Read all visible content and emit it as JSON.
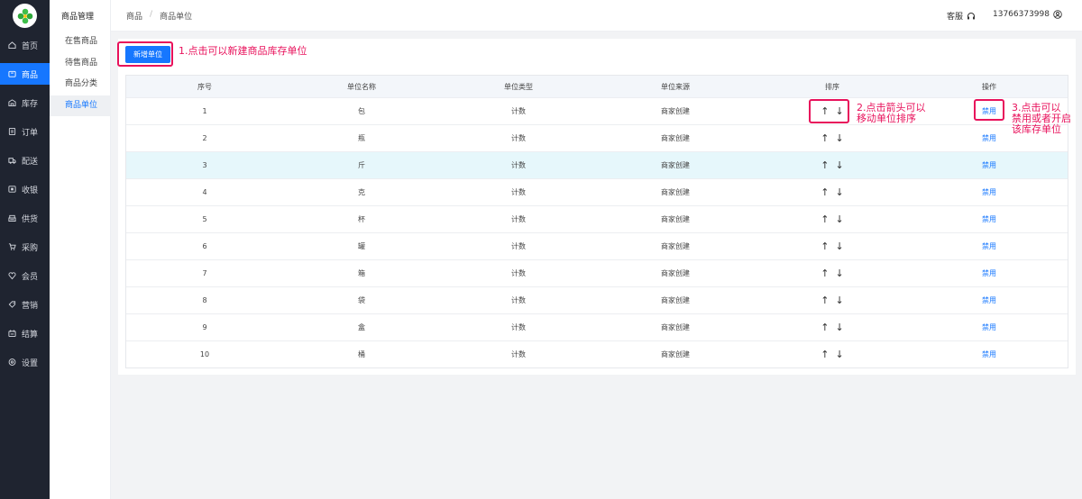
{
  "sidebar": {
    "items": [
      {
        "label": "首页",
        "icon": "home-icon"
      },
      {
        "label": "商品",
        "icon": "product-icon"
      },
      {
        "label": "库存",
        "icon": "inventory-icon"
      },
      {
        "label": "订单",
        "icon": "order-icon"
      },
      {
        "label": "配送",
        "icon": "truck-icon"
      },
      {
        "label": "收银",
        "icon": "cashier-icon"
      },
      {
        "label": "供货",
        "icon": "supply-icon"
      },
      {
        "label": "采购",
        "icon": "cart-icon"
      },
      {
        "label": "会员",
        "icon": "member-icon"
      },
      {
        "label": "营销",
        "icon": "tag-icon"
      },
      {
        "label": "结算",
        "icon": "settle-icon"
      },
      {
        "label": "设置",
        "icon": "settings-icon"
      }
    ],
    "active_index": 1
  },
  "subside": {
    "title": "商品管理",
    "items": [
      "在售商品",
      "待售商品",
      "商品分类",
      "商品单位"
    ],
    "active_index": 3
  },
  "header": {
    "breadcrumb": [
      "商品",
      "商品单位"
    ],
    "service_label": "客服",
    "phone": "13766373998"
  },
  "toolbar": {
    "add_label": "新增单位"
  },
  "annotations": {
    "note1": "1.点击可以新建商品库存单位",
    "note2_line1": "2.点击箭头可以",
    "note2_line2": "移动单位排序",
    "note3_line1": "3.点击可以",
    "note3_line2": "禁用或者开启",
    "note3_line3": "该库存单位"
  },
  "table": {
    "columns": [
      "序号",
      "单位名称",
      "单位类型",
      "单位来源",
      "排序",
      "操作"
    ],
    "rows": [
      {
        "no": "1",
        "name": "包",
        "type": "计数",
        "source": "商家创建",
        "action": "禁用"
      },
      {
        "no": "2",
        "name": "瓶",
        "type": "计数",
        "source": "商家创建",
        "action": "禁用"
      },
      {
        "no": "3",
        "name": "斤",
        "type": "计数",
        "source": "商家创建",
        "action": "禁用"
      },
      {
        "no": "4",
        "name": "克",
        "type": "计数",
        "source": "商家创建",
        "action": "禁用"
      },
      {
        "no": "5",
        "name": "杯",
        "type": "计数",
        "source": "商家创建",
        "action": "禁用"
      },
      {
        "no": "6",
        "name": "罐",
        "type": "计数",
        "source": "商家创建",
        "action": "禁用"
      },
      {
        "no": "7",
        "name": "箱",
        "type": "计数",
        "source": "商家创建",
        "action": "禁用"
      },
      {
        "no": "8",
        "name": "袋",
        "type": "计数",
        "source": "商家创建",
        "action": "禁用"
      },
      {
        "no": "9",
        "name": "盒",
        "type": "计数",
        "source": "商家创建",
        "action": "禁用"
      },
      {
        "no": "10",
        "name": "桶",
        "type": "计数",
        "source": "商家创建",
        "action": "禁用"
      }
    ],
    "highlight_row": 2,
    "arrow_up": "↑",
    "arrow_down": "↓"
  },
  "colors": {
    "accent": "#1677ff",
    "annotation": "#e8115b",
    "sidebar_bg": "#1f2430"
  }
}
